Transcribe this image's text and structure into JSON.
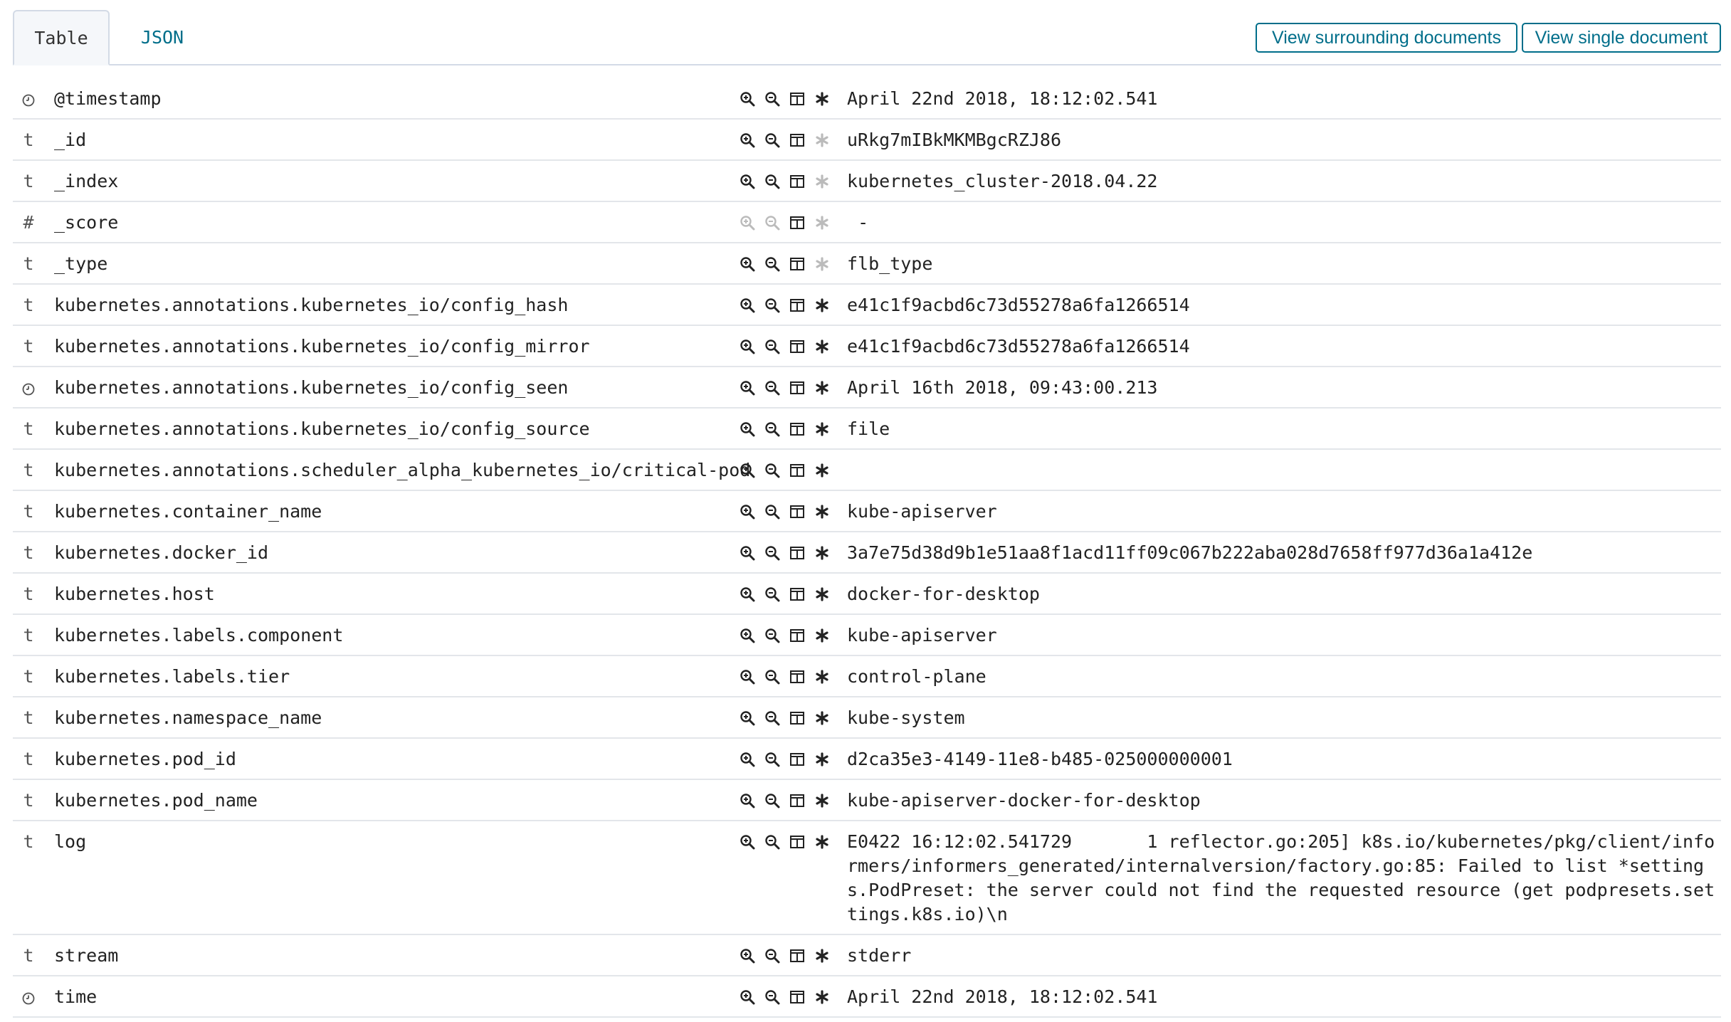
{
  "tabs": [
    {
      "label": "Table",
      "active": true
    },
    {
      "label": "JSON",
      "active": false
    }
  ],
  "buttons": {
    "surrounding": "View surrounding documents",
    "single": "View single document"
  },
  "colors": {
    "link": "#006e8a",
    "border": "#d3dae6"
  },
  "rows": [
    {
      "type": "date",
      "field": "@timestamp",
      "value": "April 22nd 2018, 18:12:02.541",
      "filter_enabled": true,
      "exists_enabled": true
    },
    {
      "type": "t",
      "field": "_id",
      "value": "uRkg7mIBkMKMBgcRZJ86",
      "filter_enabled": true,
      "exists_enabled": false
    },
    {
      "type": "t",
      "field": "_index",
      "value": "kubernetes_cluster-2018.04.22",
      "filter_enabled": true,
      "exists_enabled": false
    },
    {
      "type": "#",
      "field": "_score",
      "value": " -",
      "filter_enabled": false,
      "exists_enabled": false
    },
    {
      "type": "t",
      "field": "_type",
      "value": "flb_type",
      "filter_enabled": true,
      "exists_enabled": false
    },
    {
      "type": "t",
      "field": "kubernetes.annotations.kubernetes_io/config_hash",
      "value": "e41c1f9acbd6c73d55278a6fa1266514",
      "filter_enabled": true,
      "exists_enabled": true
    },
    {
      "type": "t",
      "field": "kubernetes.annotations.kubernetes_io/config_mirror",
      "value": "e41c1f9acbd6c73d55278a6fa1266514",
      "filter_enabled": true,
      "exists_enabled": true
    },
    {
      "type": "date",
      "field": "kubernetes.annotations.kubernetes_io/config_seen",
      "value": "April 16th 2018, 09:43:00.213",
      "filter_enabled": true,
      "exists_enabled": true
    },
    {
      "type": "t",
      "field": "kubernetes.annotations.kubernetes_io/config_source",
      "value": "file",
      "filter_enabled": true,
      "exists_enabled": true
    },
    {
      "type": "t",
      "field": "kubernetes.annotations.scheduler_alpha_kubernetes_io/critical-pod",
      "value": "",
      "filter_enabled": true,
      "exists_enabled": true
    },
    {
      "type": "t",
      "field": "kubernetes.container_name",
      "value": "kube-apiserver",
      "filter_enabled": true,
      "exists_enabled": true
    },
    {
      "type": "t",
      "field": "kubernetes.docker_id",
      "value": "3a7e75d38d9b1e51aa8f1acd11ff09c067b222aba028d7658ff977d36a1a412e",
      "filter_enabled": true,
      "exists_enabled": true
    },
    {
      "type": "t",
      "field": "kubernetes.host",
      "value": "docker-for-desktop",
      "filter_enabled": true,
      "exists_enabled": true
    },
    {
      "type": "t",
      "field": "kubernetes.labels.component",
      "value": "kube-apiserver",
      "filter_enabled": true,
      "exists_enabled": true
    },
    {
      "type": "t",
      "field": "kubernetes.labels.tier",
      "value": "control-plane",
      "filter_enabled": true,
      "exists_enabled": true
    },
    {
      "type": "t",
      "field": "kubernetes.namespace_name",
      "value": "kube-system",
      "filter_enabled": true,
      "exists_enabled": true
    },
    {
      "type": "t",
      "field": "kubernetes.pod_id",
      "value": "d2ca35e3-4149-11e8-b485-025000000001",
      "filter_enabled": true,
      "exists_enabled": true
    },
    {
      "type": "t",
      "field": "kubernetes.pod_name",
      "value": "kube-apiserver-docker-for-desktop",
      "filter_enabled": true,
      "exists_enabled": true
    },
    {
      "type": "t",
      "field": "log",
      "value": "E0422 16:12:02.541729       1 reflector.go:205] k8s.io/kubernetes/pkg/client/informers/informers_generated/internalversion/factory.go:85: Failed to list *settings.PodPreset: the server could not find the requested resource (get podpresets.settings.k8s.io)\\n",
      "filter_enabled": true,
      "exists_enabled": true
    },
    {
      "type": "t",
      "field": "stream",
      "value": "stderr",
      "filter_enabled": true,
      "exists_enabled": true
    },
    {
      "type": "date",
      "field": "time",
      "value": "April 22nd 2018, 18:12:02.541",
      "filter_enabled": true,
      "exists_enabled": true
    }
  ]
}
